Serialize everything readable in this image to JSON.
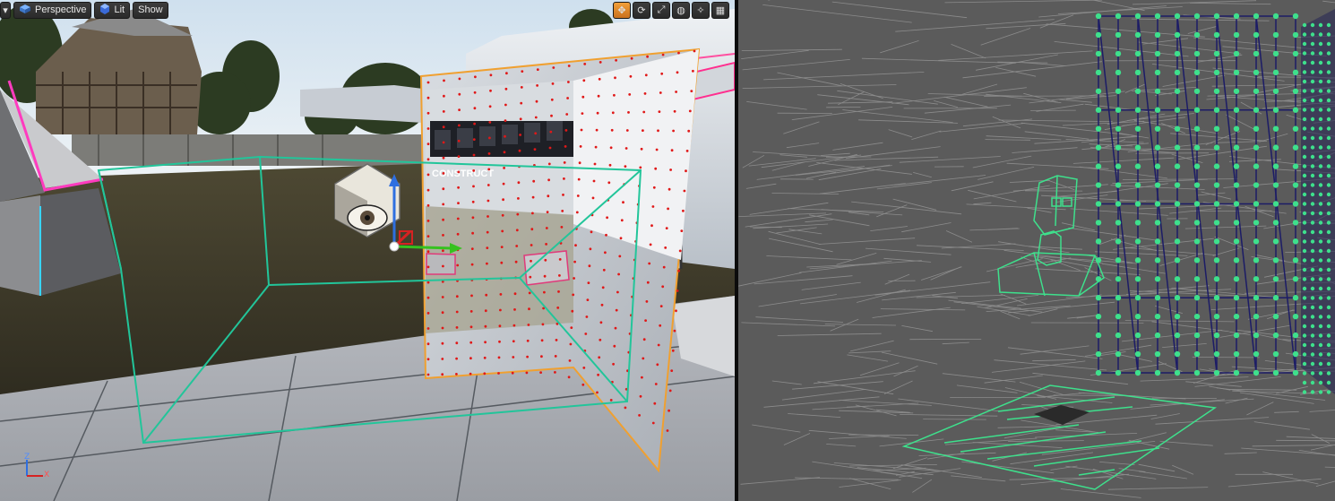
{
  "left_viewport": {
    "toolbar": {
      "view_mode": "Perspective",
      "lighting_mode": "Lit",
      "show_label": "Show"
    },
    "branding_text": "CONSTRUCT",
    "axis_labels": {
      "z": "Z",
      "x": "X"
    },
    "colors": {
      "selection_accent": "#f0a030",
      "box_reflection_capture": "#22c59a",
      "vertex_marker": "#e01818",
      "translate_x": "#36c21f",
      "translate_z": "#2e6fe0",
      "translate_y": "#d62222"
    }
  },
  "right_viewport": {
    "mode": "wireframe",
    "colors": {
      "wire": "#a6a6a6",
      "selected_mesh_vertex": "#3ee08c",
      "selected_mesh_wire": "#1a1a60",
      "highlight": "#3ee08c"
    }
  },
  "icons": {
    "menu": "menu-arrow-icon",
    "perspective": "perspective-cube-icon",
    "lit": "lit-sphere-icon",
    "translate": "translate-icon",
    "rotate": "rotate-icon",
    "scale": "scale-icon",
    "world": "world-icon",
    "surface_snap": "surface-snap-icon",
    "grid": "grid-icon"
  }
}
